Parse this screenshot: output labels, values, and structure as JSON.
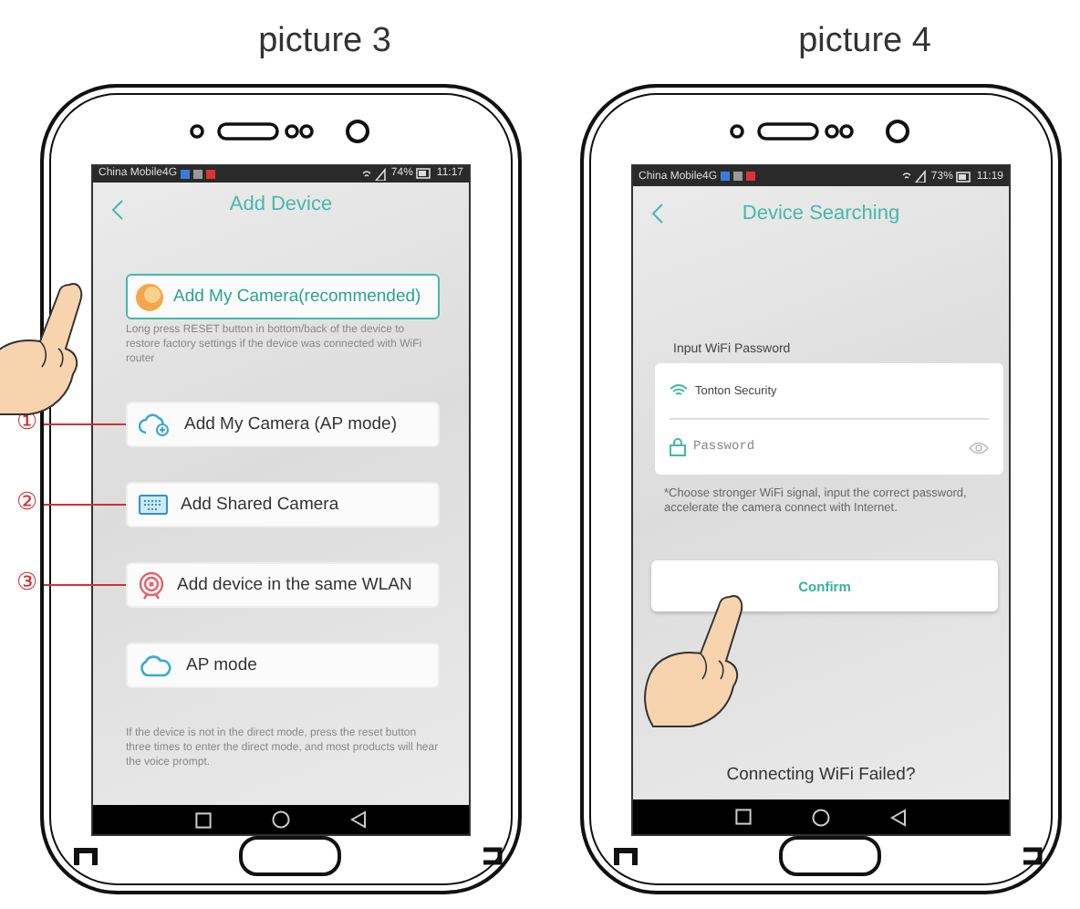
{
  "panels": [
    {
      "kind": "add_device",
      "caption": "picture 3",
      "status": {
        "carrier": "China Mobile4G",
        "battery": "74%",
        "time": "11:17"
      },
      "title": "Add Device",
      "options": [
        {
          "label": "Add My Camera(recommended)",
          "kind": "disc",
          "selected": true,
          "note": "Long press RESET button in bottom/back of the device to restore factory settings if the device was connected with WiFi router"
        },
        {
          "label": "Add My Camera (AP mode)",
          "kind": "cloud_plus",
          "selected": false,
          "callout": "①"
        },
        {
          "label": "Add Shared Camera",
          "kind": "keyboard",
          "selected": false,
          "callout": "②"
        },
        {
          "label": "Add device in the same WLAN",
          "kind": "target",
          "selected": false,
          "callout": "③"
        },
        {
          "label": "AP mode",
          "kind": "cloud",
          "selected": false,
          "note": "If the device is not in the direct mode, press the reset button three times to enter the direct mode, and most products will hear the voice prompt."
        }
      ]
    },
    {
      "kind": "wifi_password",
      "caption": "picture 4",
      "status": {
        "carrier": "China Mobile4G",
        "battery": "73%",
        "time": "11:19"
      },
      "title": "Device Searching",
      "section_label": "Input WiFi Password",
      "network": "Tonton Security",
      "password": {
        "placeholder": "Password"
      },
      "hint": "*Choose stronger WiFi signal, input the correct password, accelerate the camera connect with Internet.",
      "button": "Confirm",
      "link": "Connecting WiFi Failed?"
    }
  ]
}
